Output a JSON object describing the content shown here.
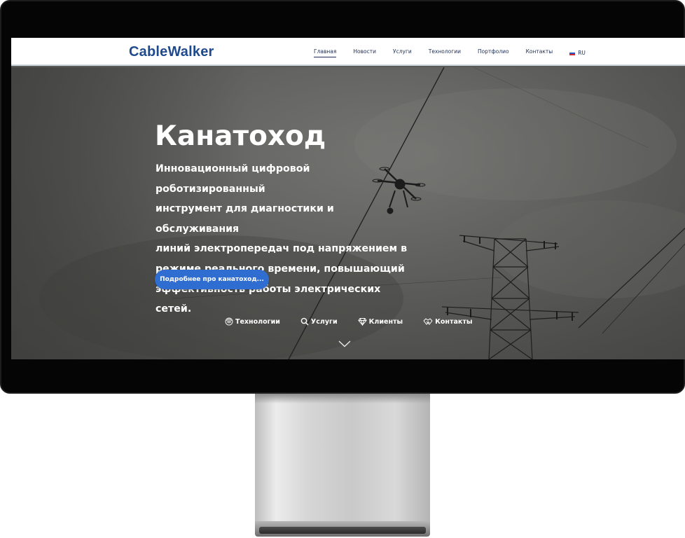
{
  "header": {
    "logo": "CableWalker",
    "nav": [
      "Главная",
      "Новости",
      "Услуги",
      "Технологии",
      "Портфолио",
      "Контакты"
    ],
    "active_nav_index": 0,
    "language": "RU"
  },
  "hero": {
    "title": "Канатоход",
    "description_lines": [
      "Инновационный цифровой роботизированный",
      "инструмент для диагностики и обслуживания",
      "линий электропередач под напряжением в",
      "режиме реального времени, повышающий",
      "эффективность работы электрических сетей."
    ],
    "button_label": "Подробнее про канатоход..."
  },
  "quick_links": [
    {
      "icon": "fingerprint-icon",
      "label": "Технологии"
    },
    {
      "icon": "search-icon",
      "label": "Услуги"
    },
    {
      "icon": "diamond-icon",
      "label": "Клиенты"
    },
    {
      "icon": "handshake-icon",
      "label": "Контакты"
    }
  ],
  "scroll_icon": "chevron-down-icon",
  "colors": {
    "brand": "#1f4b8e",
    "nav_text": "#1d2d52",
    "button": "#2f6ed0",
    "hero_text": "#ffffff"
  }
}
